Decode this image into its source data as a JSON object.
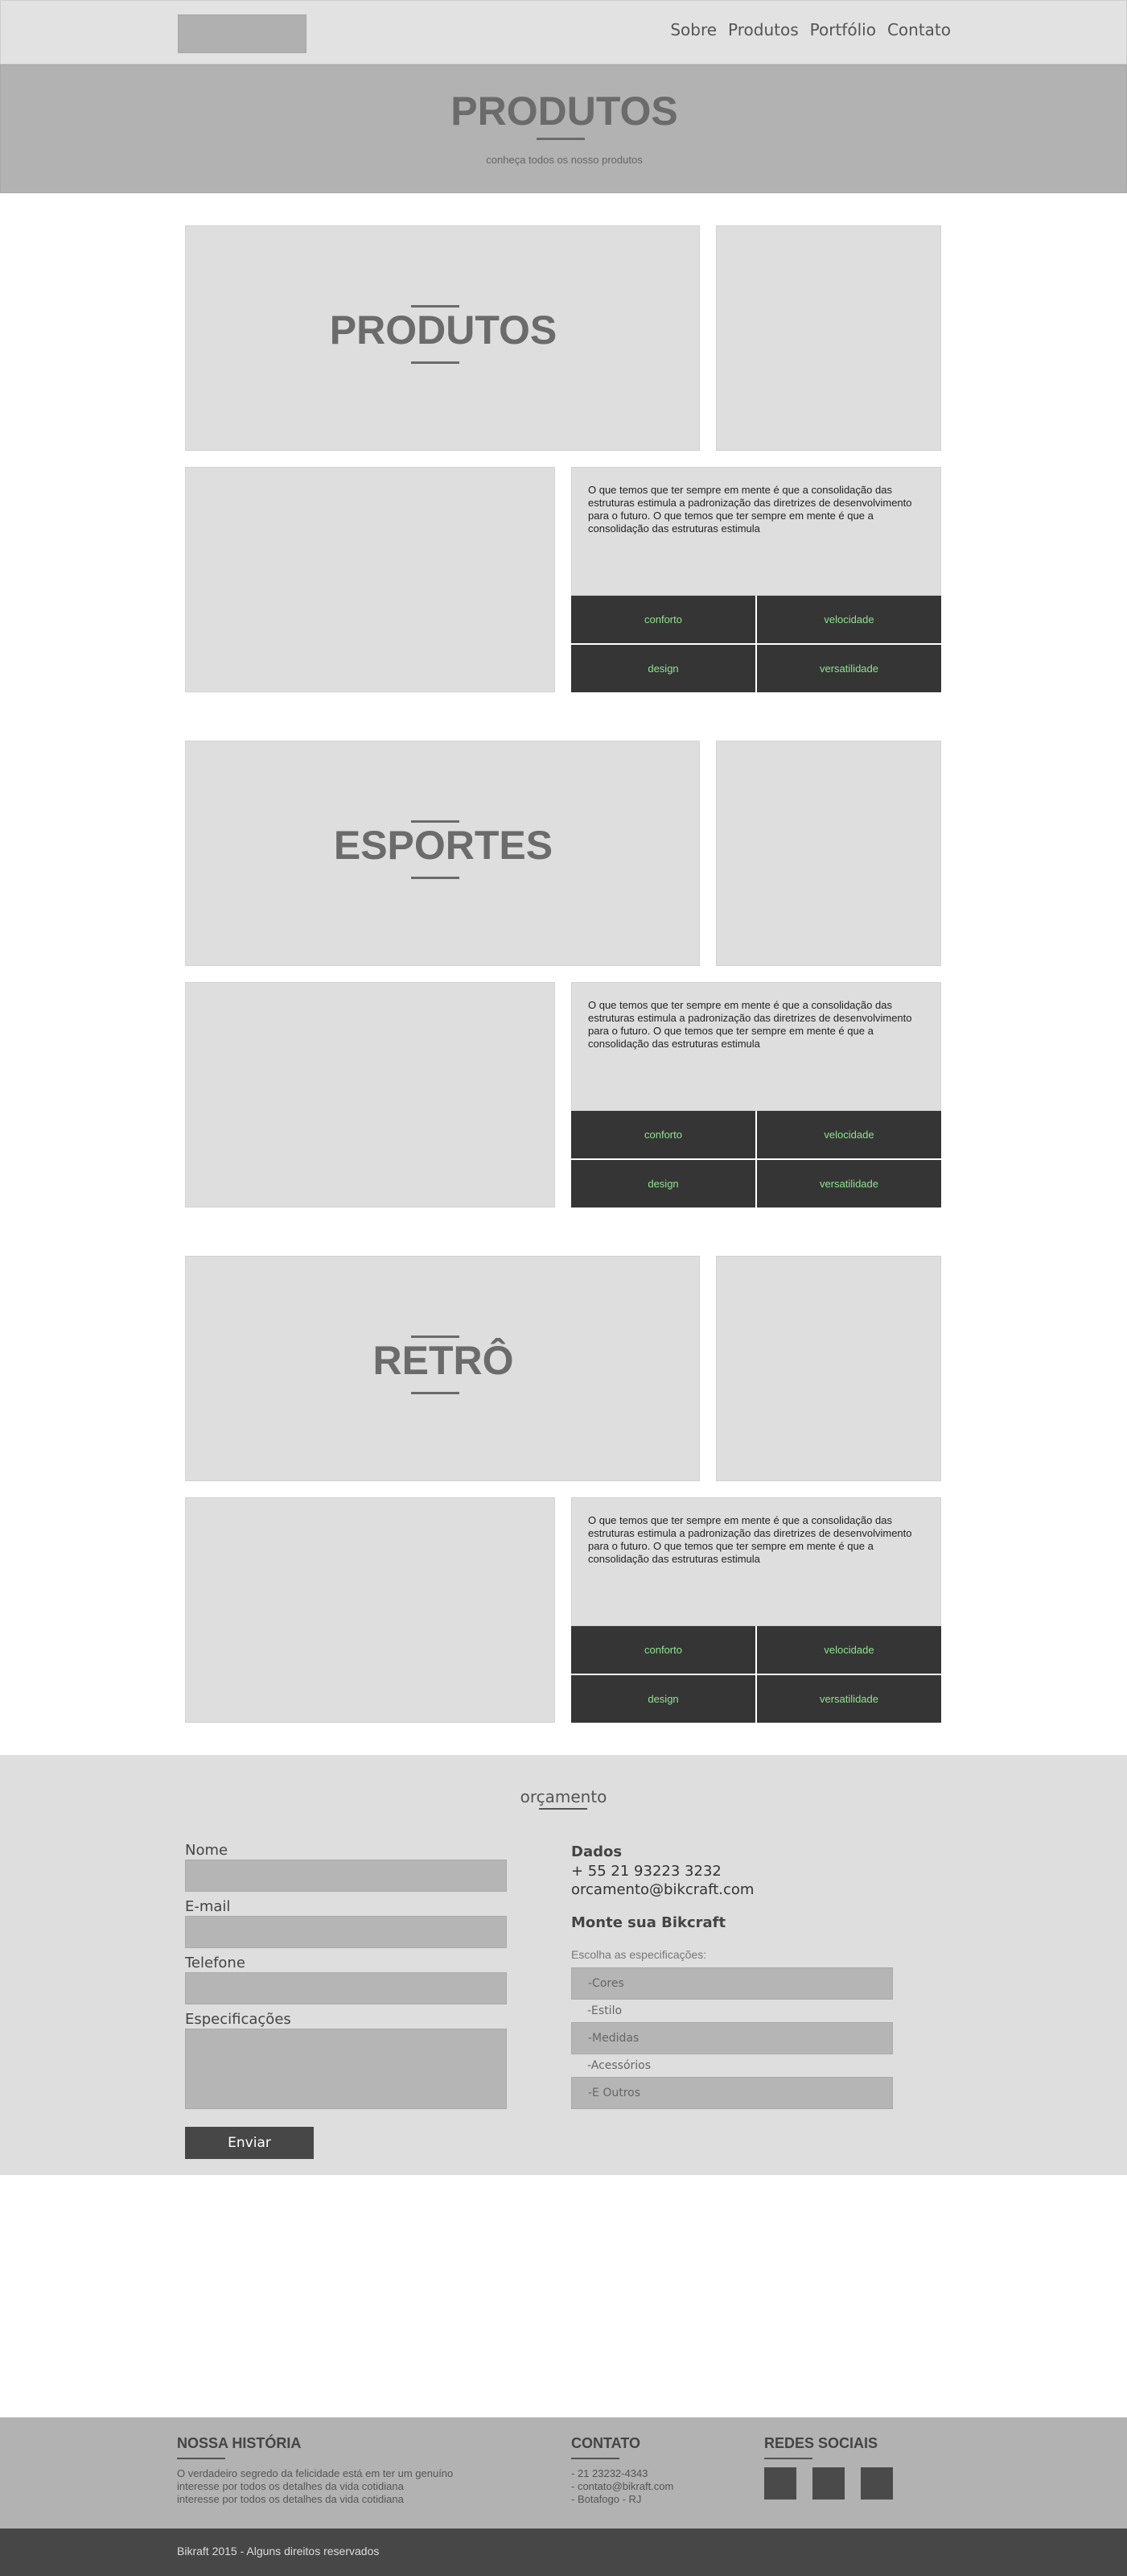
{
  "nav": {
    "items": [
      "Sobre",
      "Produtos",
      "Portfólio",
      "Contato"
    ]
  },
  "hero": {
    "title": "PRODUTOS",
    "subtitle": "conheça todos os nosso produtos"
  },
  "sections": [
    {
      "title": "PRODUTOS",
      "description": "O que temos que ter sempre em mente é que a consolidação das estruturas estimula a padronização das diretrizes de desenvolvimento para o futuro. O que temos que ter sempre em mente é que a consolidação das estruturas estimula",
      "features": [
        "conforto",
        "velocidade",
        "design",
        "versatilidade"
      ]
    },
    {
      "title": "ESPORTES",
      "description": "O que temos que ter sempre em mente é que a consolidação das estruturas estimula a padronização das diretrizes de desenvolvimento para o futuro. O que temos que ter sempre em mente é que a consolidação das estruturas estimula",
      "features": [
        "conforto",
        "velocidade",
        "design",
        "versatilidade"
      ]
    },
    {
      "title": "RETRÔ",
      "description": "O que temos que ter sempre em mente é que a consolidação das estruturas estimula a padronização das diretrizes de desenvolvimento para o futuro. O que temos que ter sempre em mente é que a consolidação das estruturas estimula",
      "features": [
        "conforto",
        "velocidade",
        "design",
        "versatilidade"
      ]
    }
  ],
  "orcamento": {
    "title": "orçamento",
    "fields": {
      "nome": "Nome",
      "email": "E-mail",
      "telefone": "Telefone",
      "especificacoes": "Especificações"
    },
    "submit": "Enviar",
    "dados_title": "Dados",
    "phone": "+ 55 21 93223 3232",
    "email": "orcamento@bikcraft.com",
    "monte_title": "Monte sua Bikcraft",
    "spec_intro": "Escolha as especificações:",
    "specs": [
      "-Cores",
      "-Estilo",
      "-Medidas",
      "-Acessórios",
      "-E Outros"
    ]
  },
  "footer": {
    "historia_title": "NOSSA HISTÓRIA",
    "historia_lines": [
      "O verdadeiro segredo da felicidade está em ter um genuíno",
      "interesse por todos os detalhes da vida cotidiana",
      "interesse por todos os detalhes da vida cotidiana"
    ],
    "contato_title": "CONTATO",
    "contato_lines": [
      "- 21 23232-4343",
      "- contato@bikraft.com",
      "- Botafogo - RJ"
    ],
    "redes_title": "REDES SOCIAIS",
    "copyright": "Bikraft 2015 - Alguns direitos reservados"
  }
}
